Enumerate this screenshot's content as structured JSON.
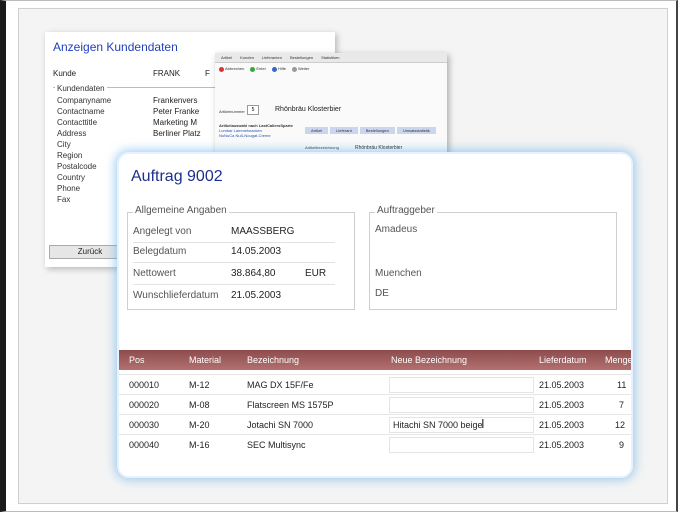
{
  "kunde_card": {
    "title": "Anzeigen Kundendaten",
    "kunde_label": "Kunde",
    "kunde_value": "FRANK",
    "kunde_extra": "F",
    "group_title": "Kundendaten",
    "fields": [
      {
        "label": "Companyname",
        "value": "Frankenvers"
      },
      {
        "label": "Contactname",
        "value": "Peter Franke"
      },
      {
        "label": "Contacttitle",
        "value": "Marketing M"
      },
      {
        "label": "Address",
        "value": "Berliner Platz"
      },
      {
        "label": "City",
        "value": ""
      },
      {
        "label": "Region",
        "value": ""
      },
      {
        "label": "Postalcode",
        "value": ""
      },
      {
        "label": "Country",
        "value": ""
      },
      {
        "label": "Phone",
        "value": ""
      },
      {
        "label": "Fax",
        "value": ""
      }
    ],
    "back_button": "Zurück"
  },
  "artikel_card": {
    "menu": [
      "Artikel",
      "Kunden",
      "Lieferanten",
      "Bestellungen",
      "Statistiken"
    ],
    "toolbar": [
      "Abbrechen",
      "Enter",
      "Hilfe",
      "Weiter"
    ],
    "artnr_label": "Artikelnummer",
    "artnr_value": "5",
    "artikel_name": "Rhönbräu Klosterbier",
    "list_title": "Artikelauswahl nach LastCallersSparte",
    "list_items": [
      "Lumbar Lammeknacken",
      "NuNuCa Nuß-Nougat-Creme"
    ],
    "tabs": [
      "Artikel",
      "Lieferant",
      "Bestellungen",
      "Umsatzstatistik"
    ],
    "bezeichnung_label": "Artikelbezeichnung",
    "bezeichnung_value": "Rhönbräu Klosterbier"
  },
  "auftrag": {
    "title": "Auftrag 9002",
    "allgemein": {
      "caption": "Allgemeine Angaben",
      "rows": [
        {
          "label": "Angelegt von",
          "value": "MAASSBERG",
          "unit": ""
        },
        {
          "label": "Belegdatum",
          "value": "14.05.2003",
          "unit": ""
        },
        {
          "label": "Nettowert",
          "value": "38.864,80",
          "unit": "EUR"
        },
        {
          "label": "Wunschlieferdatum",
          "value": "21.05.2003",
          "unit": ""
        }
      ]
    },
    "auftraggeber": {
      "caption": "Auftraggeber",
      "name": "Amadeus",
      "city": "Muenchen",
      "country": "DE"
    },
    "table": {
      "headers": [
        "Pos",
        "Material",
        "Bezeichnung",
        "Neue Bezeichnung",
        "Lieferdatum",
        "Menge"
      ],
      "rows": [
        {
          "pos": "000010",
          "material": "M-12",
          "bez": "MAG DX 15F/Fe",
          "neu": "",
          "datum": "21.05.2003",
          "menge": "11"
        },
        {
          "pos": "000020",
          "material": "M-08",
          "bez": "Flatscreen MS 1575P",
          "neu": "",
          "datum": "21.05.2003",
          "menge": "7"
        },
        {
          "pos": "000030",
          "material": "M-20",
          "bez": "Jotachi SN 7000",
          "neu": "Hitachi SN 7000 beige",
          "datum": "21.05.2003",
          "menge": "12"
        },
        {
          "pos": "000040",
          "material": "M-16",
          "bez": "SEC Multisync",
          "neu": "",
          "datum": "21.05.2003",
          "menge": "9"
        }
      ]
    }
  },
  "colors": {
    "title_blue": "#1e2e8c",
    "header_red": "#9e5c5c",
    "glow_blue": "#5aaae6"
  }
}
